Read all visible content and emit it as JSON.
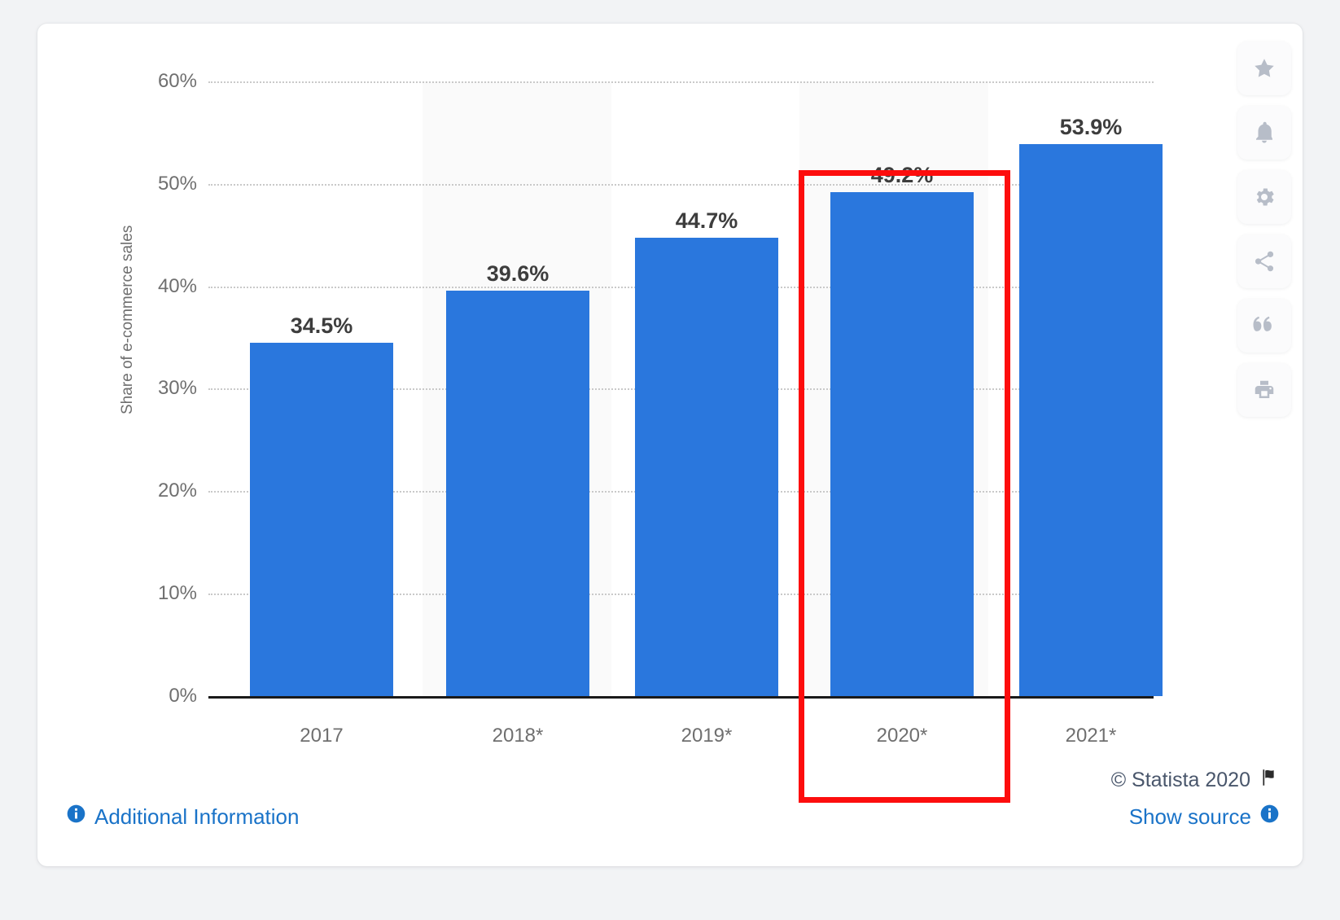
{
  "chart_data": {
    "type": "bar",
    "title": "",
    "subtitle": "",
    "xlabel": "",
    "ylabel": "Share of e-commerce sales",
    "categories": [
      "2017",
      "2018*",
      "2019*",
      "2020*",
      "2021*"
    ],
    "values": [
      34.5,
      39.6,
      44.7,
      49.2,
      53.9
    ],
    "value_labels": [
      "34.5%",
      "39.6%",
      "44.7%",
      "49.2%",
      "53.9%"
    ],
    "ylim": [
      0,
      60
    ],
    "ytick_labels": [
      "0%",
      "10%",
      "20%",
      "30%",
      "40%",
      "50%",
      "60%"
    ],
    "ytick_values": [
      0,
      10,
      20,
      30,
      40,
      50,
      60
    ],
    "grid": true,
    "legend": false,
    "bar_color": "#2a77dd",
    "highlight": {
      "category": "2020*",
      "color": "#fd0d0d"
    }
  },
  "toolbar": {
    "buttons": [
      {
        "name": "favorite",
        "icon": "star-icon"
      },
      {
        "name": "alert",
        "icon": "bell-icon"
      },
      {
        "name": "settings",
        "icon": "gear-icon"
      },
      {
        "name": "share",
        "icon": "share-icon"
      },
      {
        "name": "cite",
        "icon": "quote-icon"
      },
      {
        "name": "print",
        "icon": "print-icon"
      }
    ]
  },
  "footer": {
    "copyright": "© Statista 2020",
    "additional_information": "Additional Information",
    "show_source": "Show source"
  }
}
